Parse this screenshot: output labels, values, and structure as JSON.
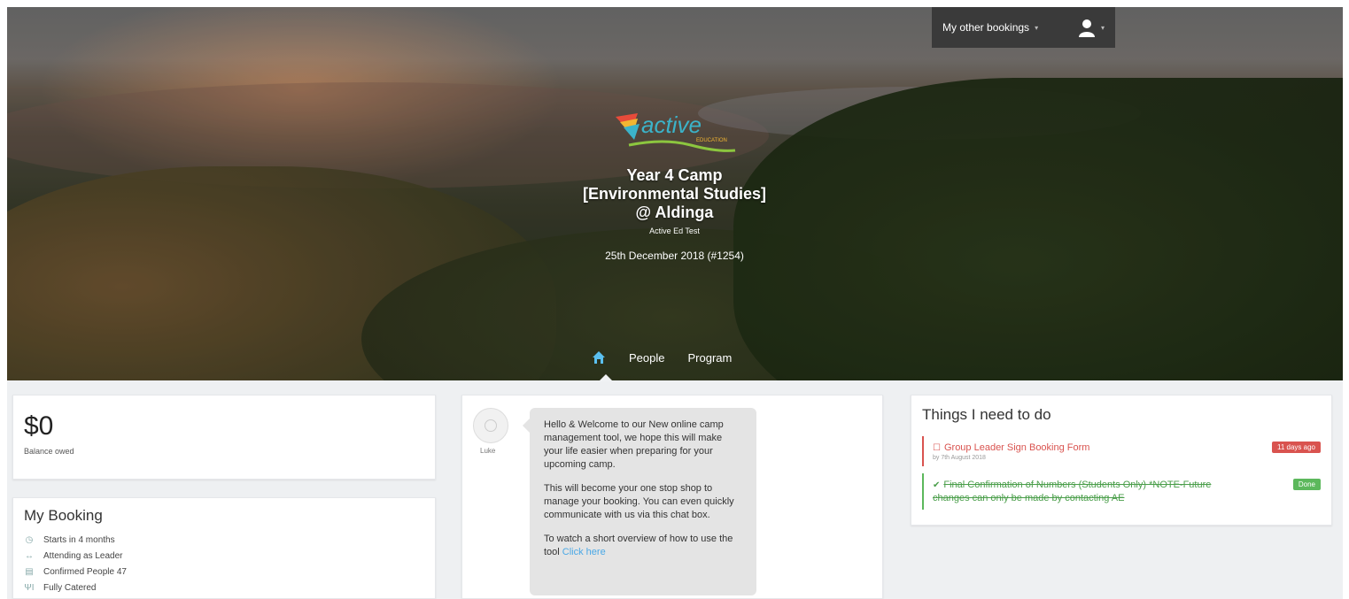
{
  "topbar": {
    "bookings_label": "My other bookings"
  },
  "event": {
    "title_line1": "Year 4 Camp",
    "title_line2": "[Environmental Studies]",
    "title_line3": "@ Aldinga",
    "organisation": "Active Ed Test",
    "date": "25th December 2018 (#1254)"
  },
  "logo": {
    "text": "active",
    "subtext": "EDUCATION"
  },
  "nav": {
    "items": [
      {
        "label": "People"
      },
      {
        "label": "Program"
      }
    ]
  },
  "balance": {
    "amount": "$0",
    "label": "Balance owed"
  },
  "booking": {
    "title": "My Booking",
    "items": [
      {
        "icon": "clock-icon",
        "label": "Starts in 4 months"
      },
      {
        "icon": "arrows-icon",
        "label": "Attending as Leader"
      },
      {
        "icon": "calendar-icon",
        "label": "Confirmed People 47"
      },
      {
        "icon": "utensils-icon",
        "label": "Fully Catered"
      }
    ]
  },
  "chat": {
    "sender": "Luke",
    "paragraph1": "Hello & Welcome to our New online camp management tool, we hope this will make your life easier when preparing for your upcoming camp.",
    "paragraph2": "This will become your one stop shop to manage your booking. You can even quickly communicate with us via this chat box.",
    "paragraph3_prefix": "To watch a short overview of how to use the tool ",
    "paragraph3_link": "Click here"
  },
  "todo": {
    "title": "Things I need to do",
    "tasks": [
      {
        "title": "Group Leader Sign Booking Form",
        "sub": "by 7th August 2018",
        "badge": "11 days ago",
        "status": "overdue"
      },
      {
        "title": "Final Confirmation of Numbers (Students Only) *NOTE-Future changes can only be made by contacting AE",
        "sub": "",
        "badge": "Done",
        "status": "done"
      }
    ]
  },
  "colors": {
    "overdue": "#d9534f",
    "done": "#5cb85c",
    "link": "#4aa8e6",
    "topbar_bg": "#3a3a3a"
  }
}
